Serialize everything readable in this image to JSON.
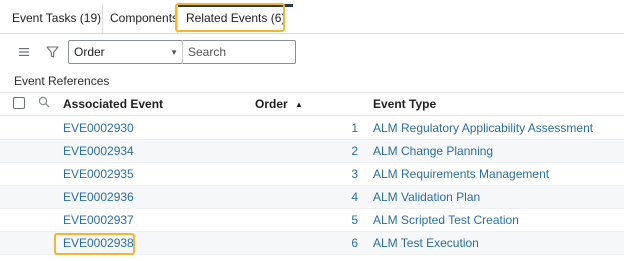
{
  "tabs": [
    {
      "label": "Event Tasks (19)"
    },
    {
      "label": "Components"
    },
    {
      "label": "Related Events (6)"
    }
  ],
  "toolbar": {
    "menu_icon": "hamburger-icon",
    "filter_icon": "filter-icon",
    "search_field": "Order",
    "search_placeholder": "Search"
  },
  "section": {
    "label": "Event References"
  },
  "table": {
    "columns": {
      "associated_event": "Associated Event",
      "order": "Order",
      "event_type": "Event Type"
    },
    "sort": {
      "column": "Order",
      "direction": "ascending"
    },
    "rows": [
      {
        "event": "EVE0002930",
        "order": "1",
        "type": "ALM Regulatory Applicability Assessment"
      },
      {
        "event": "EVE0002934",
        "order": "2",
        "type": "ALM Change Planning"
      },
      {
        "event": "EVE0002935",
        "order": "3",
        "type": "ALM Requirements Management"
      },
      {
        "event": "EVE0002936",
        "order": "4",
        "type": "ALM Validation Plan"
      },
      {
        "event": "EVE0002937",
        "order": "5",
        "type": "ALM Scripted Test Creation"
      },
      {
        "event": "EVE0002938",
        "order": "6",
        "type": "ALM Test Execution"
      }
    ]
  },
  "colors": {
    "link": "#2a6ea5",
    "highlight": "#f2b632",
    "active_tab_bar": "#293e40"
  }
}
